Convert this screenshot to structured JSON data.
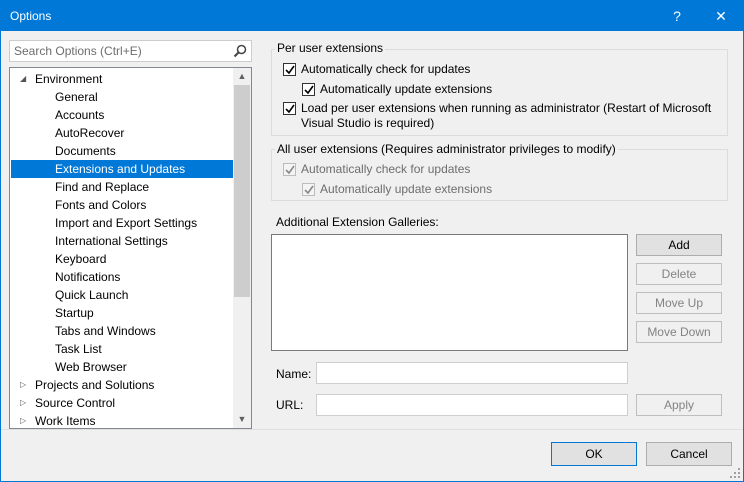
{
  "window": {
    "title": "Options",
    "help_glyph": "?",
    "close_glyph": "✕"
  },
  "search": {
    "placeholder": "Search Options (Ctrl+E)"
  },
  "tree": {
    "items": [
      {
        "label": "Environment",
        "arrow": "◢"
      },
      {
        "label": "General"
      },
      {
        "label": "Accounts"
      },
      {
        "label": "AutoRecover"
      },
      {
        "label": "Documents"
      },
      {
        "label": "Extensions and Updates"
      },
      {
        "label": "Find and Replace"
      },
      {
        "label": "Fonts and Colors"
      },
      {
        "label": "Import and Export Settings"
      },
      {
        "label": "International Settings"
      },
      {
        "label": "Keyboard"
      },
      {
        "label": "Notifications"
      },
      {
        "label": "Quick Launch"
      },
      {
        "label": "Startup"
      },
      {
        "label": "Tabs and Windows"
      },
      {
        "label": "Task List"
      },
      {
        "label": "Web Browser"
      },
      {
        "label": "Projects and Solutions",
        "arrow": "▷"
      },
      {
        "label": "Source Control",
        "arrow": "▷"
      },
      {
        "label": "Work Items",
        "arrow": "▷"
      }
    ],
    "selected_label": "Extensions and Updates",
    "scroll_up": "▲",
    "scroll_down": "▼"
  },
  "per_user": {
    "title": "Per user extensions",
    "auto_check": "Automatically check for updates",
    "auto_update": "Automatically update extensions",
    "load_admin_line1": "Load per user extensions when running as administrator (Restart of Microsoft",
    "load_admin_line2": "Visual Studio is required)"
  },
  "all_user": {
    "title": "All user extensions (Requires administrator privileges to modify)",
    "auto_check": "Automatically check for updates",
    "auto_update": "Automatically update extensions"
  },
  "galleries": {
    "label": "Additional Extension Galleries:",
    "add": "Add",
    "delete": "Delete",
    "move_up": "Move Up",
    "move_down": "Move Down",
    "name_label": "Name:",
    "url_label": "URL:",
    "apply": "Apply"
  },
  "footer": {
    "ok": "OK",
    "cancel": "Cancel"
  },
  "colors": {
    "accent": "#0078d7"
  }
}
